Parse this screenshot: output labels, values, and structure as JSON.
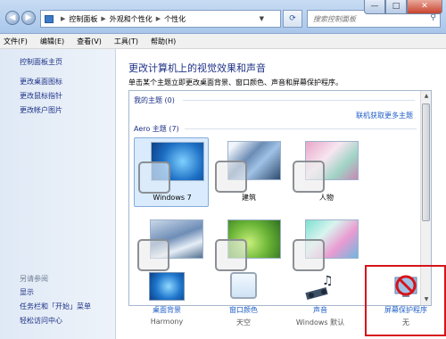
{
  "window": {
    "breadcrumb": [
      "控制面板",
      "外观和个性化",
      "个性化"
    ],
    "search_placeholder": "搜索控制面板",
    "controls": {
      "minimize": "—",
      "maximize": "□",
      "close": "✕"
    }
  },
  "menu": [
    "文件(F)",
    "编辑(E)",
    "查看(V)",
    "工具(T)",
    "帮助(H)"
  ],
  "sidebar": {
    "links": [
      "控制面板主页",
      "更改桌面图标",
      "更改鼠标指针",
      "更改帐户图片"
    ],
    "see_also_title": "另请参阅",
    "see_also": [
      "显示",
      "任务栏和「开始」菜单",
      "轻松访问中心"
    ]
  },
  "main": {
    "heading": "更改计算机上的视觉效果和声音",
    "subtitle": "单击某个主题立即更改桌面背景、窗口颜色、声音和屏幕保护程序。",
    "my_themes": "我的主题 (0)",
    "online_link": "联机获取更多主题",
    "aero_themes": "Aero 主题 (7)",
    "themes": [
      {
        "label": "Windows 7",
        "selected": true
      },
      {
        "label": "建筑"
      },
      {
        "label": "人物"
      },
      {
        "label": ""
      },
      {
        "label": ""
      },
      {
        "label": ""
      }
    ]
  },
  "bottom": [
    {
      "label": "桌面背景",
      "sub": "Harmony"
    },
    {
      "label": "窗口颜色",
      "sub": "天空"
    },
    {
      "label": "声音",
      "sub": "Windows 默认"
    },
    {
      "label": "屏幕保护程序",
      "sub": "无"
    }
  ],
  "colors": {
    "link": "#1e5dc7",
    "highlight": "#d6141b",
    "sidebar": "#dfe9f5"
  }
}
